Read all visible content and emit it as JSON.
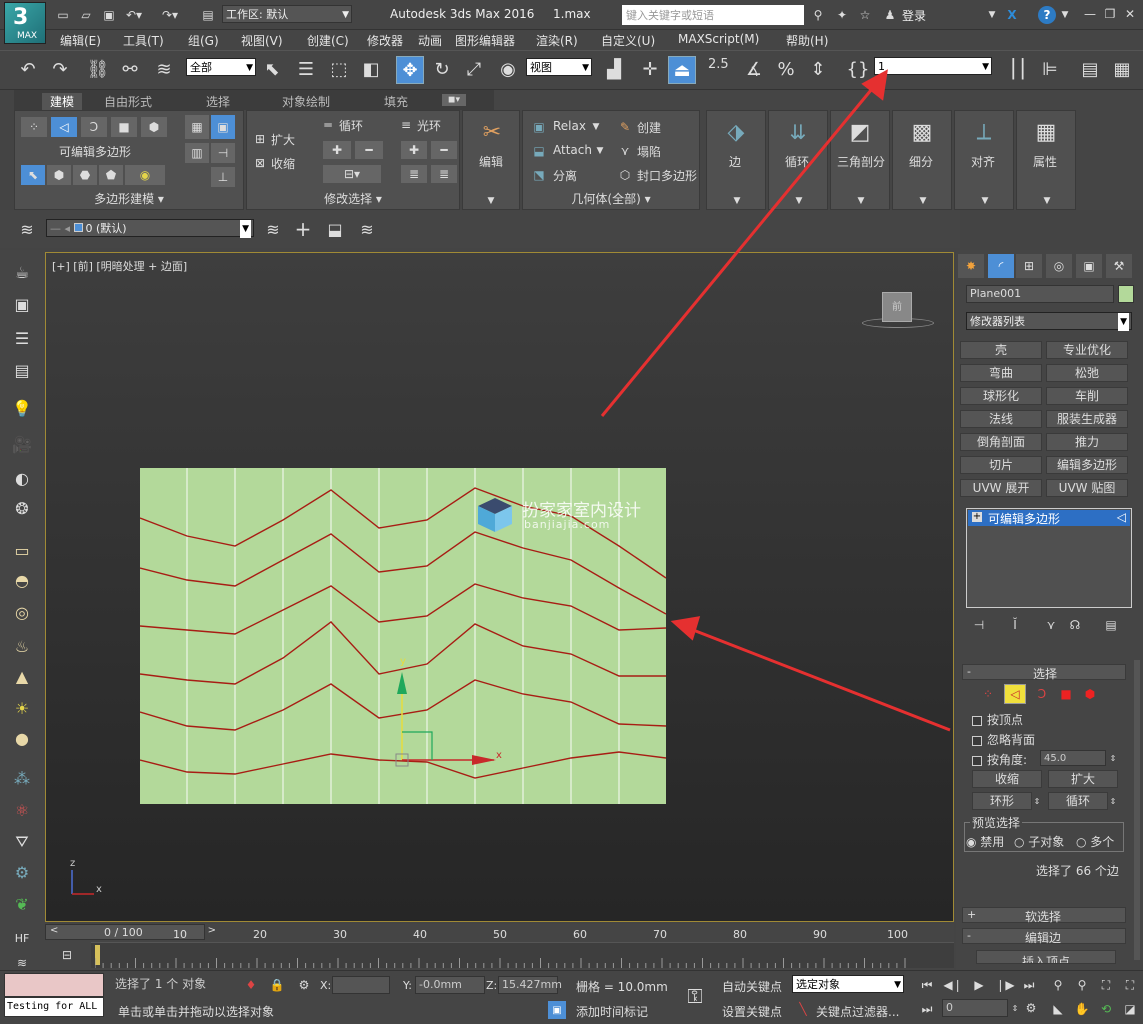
{
  "app": {
    "logo_text": "MAX",
    "workspace": "工作区: 默认",
    "title": "Autodesk 3ds Max 2016",
    "file": "1.max",
    "search_placeholder": "键入关键字或短语",
    "login": "登录"
  },
  "menu": [
    "编辑(E)",
    "工具(T)",
    "组(G)",
    "视图(V)",
    "创建(C)",
    "修改器",
    "动画",
    "图形编辑器",
    "渲染(R)",
    "自定义(U)",
    "MAXScript(M)",
    "帮助(H)"
  ],
  "toolbar": {
    "filter": "全部",
    "ref_coord": "视图",
    "snap_value": "2.5",
    "selection_set": "1"
  },
  "ribbon": {
    "tabs": [
      "建模",
      "自由形式",
      "选择",
      "对象绘制",
      "填充"
    ],
    "poly_label": "可编辑多边形",
    "poly_model_panel": "多边形建模 ▾",
    "modify_sel_panel": "修改选择 ▾",
    "grow": "扩大",
    "shrink": "收缩",
    "loop": "循环",
    "ring": "光环",
    "edit": "编辑",
    "relax": "Relax",
    "create": "创建",
    "attach": "Attach",
    "collapse": "塌陷",
    "detach": "分离",
    "cap": "封口多边形",
    "geometry_panel": "几何体(全部) ▾",
    "big": [
      "边",
      "循环",
      "三角剖分",
      "细分",
      "对齐",
      "属性"
    ]
  },
  "layer": {
    "name": "0 (默认)"
  },
  "viewport": {
    "label": "[+] [前] [明暗处理 + 边面]",
    "cube": "前",
    "watermark": "扮家家室内设计",
    "watermark_url": "banjiajia.com",
    "gizmo_x": "x",
    "gizmo_y": "y",
    "axis_z": "z",
    "axis_x": "x"
  },
  "cmd": {
    "object_name": "Plane001",
    "modifier_list": "修改器列表",
    "mods": [
      "壳",
      "专业优化",
      "弯曲",
      "松弛",
      "球形化",
      "车削",
      "法线",
      "服装生成器",
      "倒角剖面",
      "推力",
      "切片",
      "编辑多边形",
      "UVW 展开",
      "UVW 贴图"
    ],
    "stack_item": "可编辑多边形",
    "rollout_select": "选择",
    "by_vertex": "按顶点",
    "ignore_back": "忽略背面",
    "by_angle": "按角度:",
    "angle_value": "45.0",
    "shrink": "收缩",
    "grow": "扩大",
    "ring": "环形",
    "loop": "循环",
    "preview": "预览选择",
    "preview_opts": [
      "禁用",
      "子对象",
      "多个"
    ],
    "selected_info": "选择了 66 个边",
    "rollout_soft": "软选择",
    "rollout_edit_edges": "编辑边",
    "insert_vertex": "插入顶点"
  },
  "timeline": {
    "frame": "0 / 100",
    "ticks": [
      "10",
      "20",
      "30",
      "40",
      "50",
      "60",
      "70",
      "80",
      "90",
      "100"
    ]
  },
  "status": {
    "maxscript": "Testing for ALL",
    "selected": "选择了 1 个 对象",
    "prompt": "单击或单击并拖动以选择对象",
    "x_label": "X:",
    "x_value": "",
    "y_label": "Y:",
    "y_value": "-0.0mm",
    "z_label": "Z:",
    "z_value": "15.427mm",
    "grid": "栅格 = 10.0mm",
    "add_time_tag": "添加时间标记",
    "auto_key": "自动关键点",
    "set_key": "设置关键点",
    "key_mode": "选定对象",
    "key_filter": "关键点过滤器...",
    "frame_value": "0"
  },
  "colors": {
    "plane": "#b3d99a",
    "edge": "#a81d14",
    "arrow": "#e53030",
    "viewport_border": "#a08a35",
    "accent": "#4d8fd6"
  }
}
